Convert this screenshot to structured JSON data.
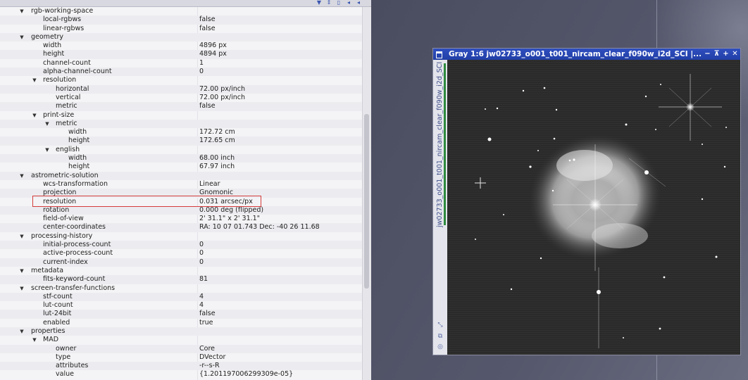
{
  "tree": {
    "rows": [
      {
        "key": "rgb-working-space",
        "value": "",
        "level": 1,
        "toggle": "down"
      },
      {
        "key": "local-rgbws",
        "value": "false",
        "level": 2,
        "toggle": ""
      },
      {
        "key": "linear-rgbws",
        "value": "false",
        "level": 2,
        "toggle": ""
      },
      {
        "key": "geometry",
        "value": "",
        "level": 1,
        "toggle": "down"
      },
      {
        "key": "width",
        "value": "4896 px",
        "level": 2,
        "toggle": ""
      },
      {
        "key": "height",
        "value": "4894 px",
        "level": 2,
        "toggle": ""
      },
      {
        "key": "channel-count",
        "value": "1",
        "level": 2,
        "toggle": ""
      },
      {
        "key": "alpha-channel-count",
        "value": "0",
        "level": 2,
        "toggle": ""
      },
      {
        "key": "resolution",
        "value": "",
        "level": 2,
        "toggle": "down"
      },
      {
        "key": "horizontal",
        "value": "72.00 px/inch",
        "level": 3,
        "toggle": ""
      },
      {
        "key": "vertical",
        "value": "72.00 px/inch",
        "level": 3,
        "toggle": ""
      },
      {
        "key": "metric",
        "value": "false",
        "level": 3,
        "toggle": ""
      },
      {
        "key": "print-size",
        "value": "",
        "level": 2,
        "toggle": "down"
      },
      {
        "key": "metric",
        "value": "",
        "level": 3,
        "toggle": "down"
      },
      {
        "key": "width",
        "value": "172.72 cm",
        "level": 4,
        "toggle": ""
      },
      {
        "key": "height",
        "value": "172.65 cm",
        "level": 4,
        "toggle": ""
      },
      {
        "key": "english",
        "value": "",
        "level": 3,
        "toggle": "down"
      },
      {
        "key": "width",
        "value": "68.00 inch",
        "level": 4,
        "toggle": ""
      },
      {
        "key": "height",
        "value": "67.97 inch",
        "level": 4,
        "toggle": ""
      },
      {
        "key": "astrometric-solution",
        "value": "",
        "level": 1,
        "toggle": "down"
      },
      {
        "key": "wcs-transformation",
        "value": "Linear",
        "level": 2,
        "toggle": ""
      },
      {
        "key": "projection",
        "value": "Gnomonic",
        "level": 2,
        "toggle": ""
      },
      {
        "key": "resolution",
        "value": "0.031 arcsec/px",
        "level": 2,
        "toggle": ""
      },
      {
        "key": "rotation",
        "value": "0.000 deg (flipped)",
        "level": 2,
        "toggle": ""
      },
      {
        "key": "field-of-view",
        "value": "2' 31.1\" x 2' 31.1\"",
        "level": 2,
        "toggle": ""
      },
      {
        "key": "center-coordinates",
        "value": "RA: 10 07 01.743  Dec: -40 26 11.68",
        "level": 2,
        "toggle": ""
      },
      {
        "key": "processing-history",
        "value": "",
        "level": 1,
        "toggle": "down"
      },
      {
        "key": "initial-process-count",
        "value": "0",
        "level": 2,
        "toggle": ""
      },
      {
        "key": "active-process-count",
        "value": "0",
        "level": 2,
        "toggle": ""
      },
      {
        "key": "current-index",
        "value": "0",
        "level": 2,
        "toggle": ""
      },
      {
        "key": "metadata",
        "value": "",
        "level": 1,
        "toggle": "down"
      },
      {
        "key": "fits-keyword-count",
        "value": "81",
        "level": 2,
        "toggle": ""
      },
      {
        "key": "screen-transfer-functions",
        "value": "",
        "level": 1,
        "toggle": "down"
      },
      {
        "key": "stf-count",
        "value": "4",
        "level": 2,
        "toggle": ""
      },
      {
        "key": "lut-count",
        "value": "4",
        "level": 2,
        "toggle": ""
      },
      {
        "key": "lut-24bit",
        "value": "false",
        "level": 2,
        "toggle": ""
      },
      {
        "key": "enabled",
        "value": "true",
        "level": 2,
        "toggle": ""
      },
      {
        "key": "properties",
        "value": "",
        "level": 1,
        "toggle": "down"
      },
      {
        "key": "MAD",
        "value": "",
        "level": 2,
        "toggle": "down"
      },
      {
        "key": "owner",
        "value": "Core",
        "level": 3,
        "toggle": ""
      },
      {
        "key": "type",
        "value": "DVector",
        "level": 3,
        "toggle": ""
      },
      {
        "key": "attributes",
        "value": "-r--s-R",
        "level": 3,
        "toggle": ""
      },
      {
        "key": "value",
        "value": "{1.201197006299309e-05}",
        "level": 3,
        "toggle": ""
      }
    ]
  },
  "image_window": {
    "title": "Gray 1:6 jw02733_o001_t001_nircam_clear_f090w_i2d_SCI |...",
    "side_label": "jw02733_o001_t001_nircam_clear_f090w_i2d_SCI",
    "buttons": [
      "pin-icon",
      "maximize-icon",
      "shade-icon",
      "close-icon"
    ]
  },
  "colors": {
    "highlight": "#d43c3c",
    "titlebar": "#2f4fbf",
    "workspace": "#4b4d5f"
  }
}
